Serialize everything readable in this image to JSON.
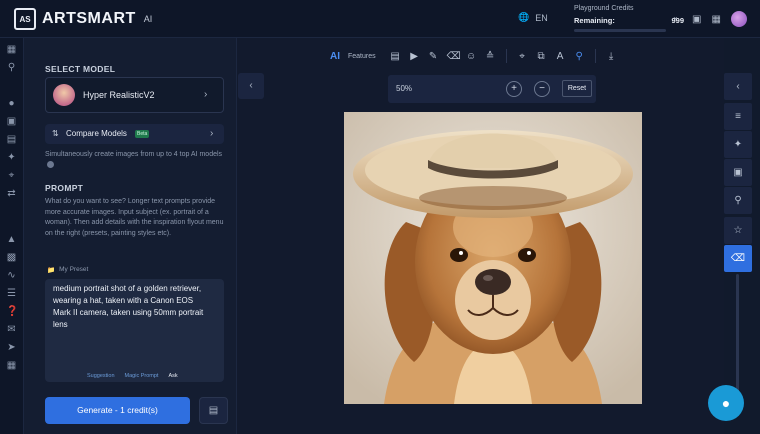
{
  "brand": {
    "name": "ARTSMART",
    "suffix": "AI",
    "box_letters": "AS"
  },
  "header": {
    "language": "EN",
    "credits_title": "Playground Credits",
    "remaining_label": "Remaining:",
    "remaining_value": "999",
    "icons": [
      "globe-icon",
      "chevron-down-icon",
      "map-icon",
      "grid-icon",
      "avatar"
    ]
  },
  "left_rail": [
    "apps-icon",
    "search-icon",
    "users-icon",
    "image-icon",
    "document-icon",
    "magic-icon",
    "crop-icon",
    "swap-icon",
    "tag-icon",
    "layers-icon",
    "wave-icon",
    "list-icon",
    "help-icon",
    "mail-icon",
    "rocket-icon",
    "table-icon"
  ],
  "panel": {
    "select_model_title": "SELECT MODEL",
    "model_name": "Hyper RealisticV2",
    "compare_label": "Compare Models",
    "beta_badge": "Beta",
    "compare_desc": "Simultaneously create images from up to 4 top AI models",
    "prompt_title": "PROMPT",
    "prompt_desc": "What do you want to see? Longer text prompts provide more accurate images. Input subject (ex. portrait of a woman). Then add details with the inspiration flyout menu on the right (presets, painting styles etc).",
    "preset_label": "My Preset",
    "prompt_text": "medium portrait shot of a golden retriever, wearing a hat, taken with a Canon EOS Mark II camera, taken using 50mm portrait lens",
    "prompt_actions": [
      "Suggestion",
      "Magic Prompt",
      "Ask"
    ],
    "generate_label": "Generate - 1 credit(s)"
  },
  "toolbar": {
    "ai_label": "AI",
    "features_label": "Features",
    "icons": [
      "folder-icon",
      "play-icon",
      "brush-icon",
      "eraser-icon",
      "smile-icon",
      "chevrons-up-icon",
      "crop-icon",
      "copy-icon",
      "text-icon",
      "zoom-icon",
      "download-icon"
    ]
  },
  "zoom": {
    "value": "50%",
    "reset_label": "Reset"
  },
  "right_rail": [
    "chevron-left-icon",
    "sliders-icon",
    "wand-icon",
    "image-edit-icon",
    "image-search-icon",
    "star-icon",
    "eraser-icon"
  ],
  "colors": {
    "accent": "#2f6fe0",
    "background": "#111a2c",
    "panel": "#141d31",
    "chat": "#1a9ad6"
  }
}
